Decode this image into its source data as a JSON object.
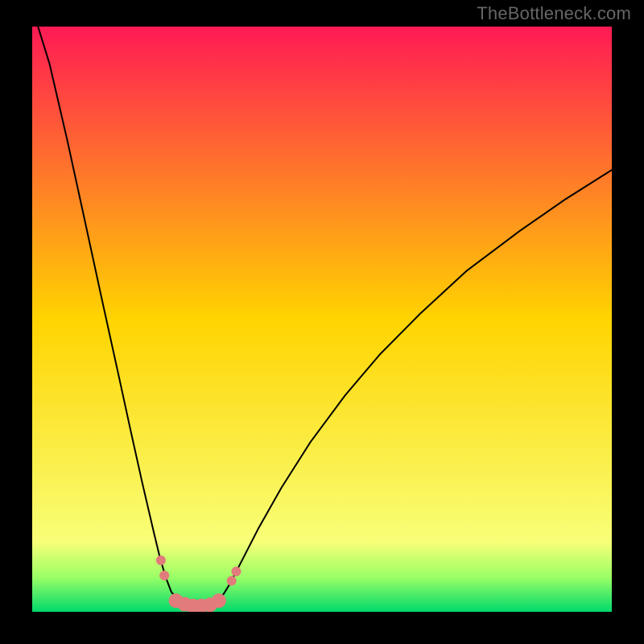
{
  "watermark": "TheBottleneck.com",
  "chart_data": {
    "type": "line",
    "title": "",
    "xlabel": "",
    "ylabel": "",
    "xlim": [
      0,
      100
    ],
    "ylim": [
      0,
      100
    ],
    "background_gradient": {
      "stops": [
        {
          "offset": 0,
          "color": "#ff1a54"
        },
        {
          "offset": 50,
          "color": "#ffd400"
        },
        {
          "offset": 88,
          "color": "#f8ff77"
        },
        {
          "offset": 94,
          "color": "#9cff66"
        },
        {
          "offset": 100,
          "color": "#00d96b"
        }
      ]
    },
    "series": [
      {
        "name": "bottleneck-curve",
        "stroke": "#000000",
        "stroke_width": 2,
        "points": [
          {
            "x": 1.0,
            "y": 100.0
          },
          {
            "x": 3.0,
            "y": 93.6
          },
          {
            "x": 6.0,
            "y": 80.8
          },
          {
            "x": 9.0,
            "y": 67.2
          },
          {
            "x": 12.0,
            "y": 53.5
          },
          {
            "x": 15.0,
            "y": 40.0
          },
          {
            "x": 17.0,
            "y": 30.9
          },
          {
            "x": 19.0,
            "y": 22.0
          },
          {
            "x": 21.0,
            "y": 13.5
          },
          {
            "x": 22.0,
            "y": 9.4
          },
          {
            "x": 23.0,
            "y": 6.0
          },
          {
            "x": 24.0,
            "y": 3.4
          },
          {
            "x": 25.5,
            "y": 1.6
          },
          {
            "x": 27.0,
            "y": 1.1
          },
          {
            "x": 28.5,
            "y": 1.0
          },
          {
            "x": 30.0,
            "y": 1.1
          },
          {
            "x": 31.5,
            "y": 1.6
          },
          {
            "x": 33.0,
            "y": 3.0
          },
          {
            "x": 34.0,
            "y": 4.6
          },
          {
            "x": 36.0,
            "y": 8.4
          },
          {
            "x": 39.0,
            "y": 14.2
          },
          {
            "x": 43.0,
            "y": 21.2
          },
          {
            "x": 48.0,
            "y": 29.0
          },
          {
            "x": 54.0,
            "y": 37.0
          },
          {
            "x": 60.0,
            "y": 44.0
          },
          {
            "x": 67.0,
            "y": 51.0
          },
          {
            "x": 75.0,
            "y": 58.3
          },
          {
            "x": 84.0,
            "y": 65.0
          },
          {
            "x": 92.0,
            "y": 70.5
          },
          {
            "x": 100.0,
            "y": 75.5
          }
        ]
      }
    ],
    "markers": {
      "color": "#e27b7b",
      "r_small": 6,
      "r_large": 9,
      "points": [
        {
          "x": 22.2,
          "y": 8.8,
          "size": "small"
        },
        {
          "x": 22.8,
          "y": 6.2,
          "size": "small"
        },
        {
          "x": 24.8,
          "y": 1.9,
          "size": "large"
        },
        {
          "x": 26.3,
          "y": 1.3,
          "size": "large"
        },
        {
          "x": 27.7,
          "y": 1.0,
          "size": "large"
        },
        {
          "x": 29.2,
          "y": 1.0,
          "size": "large"
        },
        {
          "x": 30.7,
          "y": 1.2,
          "size": "large"
        },
        {
          "x": 32.2,
          "y": 1.9,
          "size": "large"
        },
        {
          "x": 34.4,
          "y": 5.3,
          "size": "small"
        },
        {
          "x": 35.2,
          "y": 6.9,
          "size": "small"
        }
      ]
    }
  }
}
